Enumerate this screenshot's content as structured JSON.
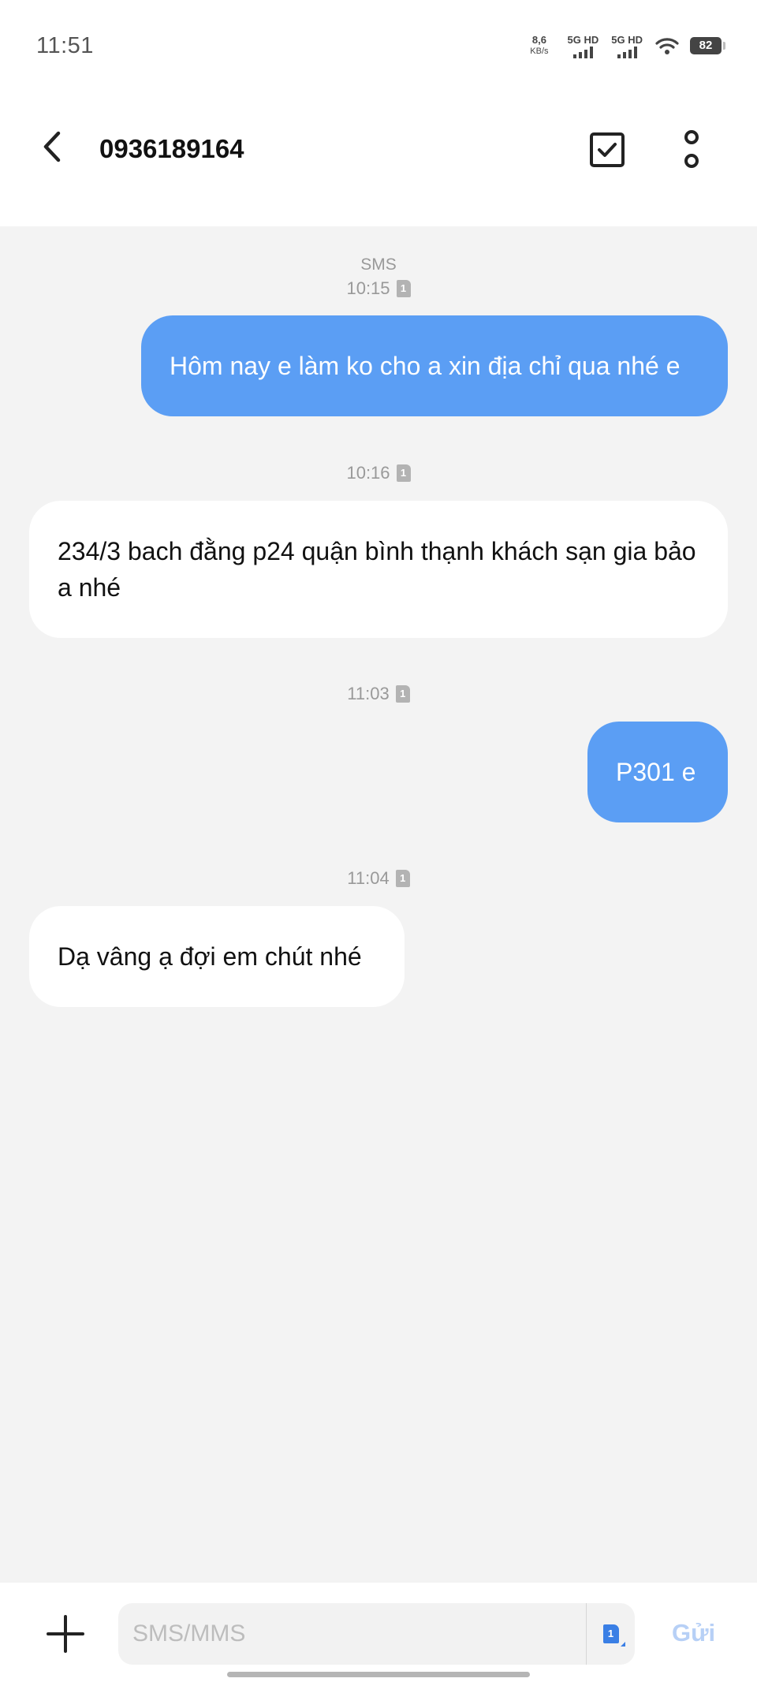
{
  "status_bar": {
    "time": "11:51",
    "net_speed_value": "8,6",
    "net_speed_unit": "KB/s",
    "sim1_label": "5G HD",
    "sim2_label": "5G HD",
    "battery": "82"
  },
  "header": {
    "title": "0936189164",
    "back_icon": "chevron-left-icon",
    "select_icon": "checkbox-icon",
    "more_icon": "more-vertical-icon"
  },
  "thread": {
    "channel_label": "SMS",
    "messages": [
      {
        "direction": "outgoing",
        "time": "10:15",
        "sim": "1",
        "text": "Hôm nay e làm ko cho a xin địa chỉ qua nhé e"
      },
      {
        "direction": "incoming",
        "time": "10:16",
        "sim": "1",
        "text": "234/3 bach đằng p24 quận bình thạnh khách sạn gia bảo a nhé"
      },
      {
        "direction": "outgoing",
        "time": "11:03",
        "sim": "1",
        "text": "P301 e"
      },
      {
        "direction": "incoming",
        "time": "11:04",
        "sim": "1",
        "text": "Dạ vâng ạ đợi em chút nhé"
      }
    ]
  },
  "composer": {
    "placeholder": "SMS/MMS",
    "value": "",
    "sim": "1",
    "send_label": "Gửi",
    "attach_icon": "plus-icon"
  },
  "colors": {
    "outgoing_bubble": "#5b9ef4",
    "incoming_bubble": "#ffffff",
    "thread_background": "#f3f3f3",
    "send_disabled": "#b7d0f6"
  }
}
